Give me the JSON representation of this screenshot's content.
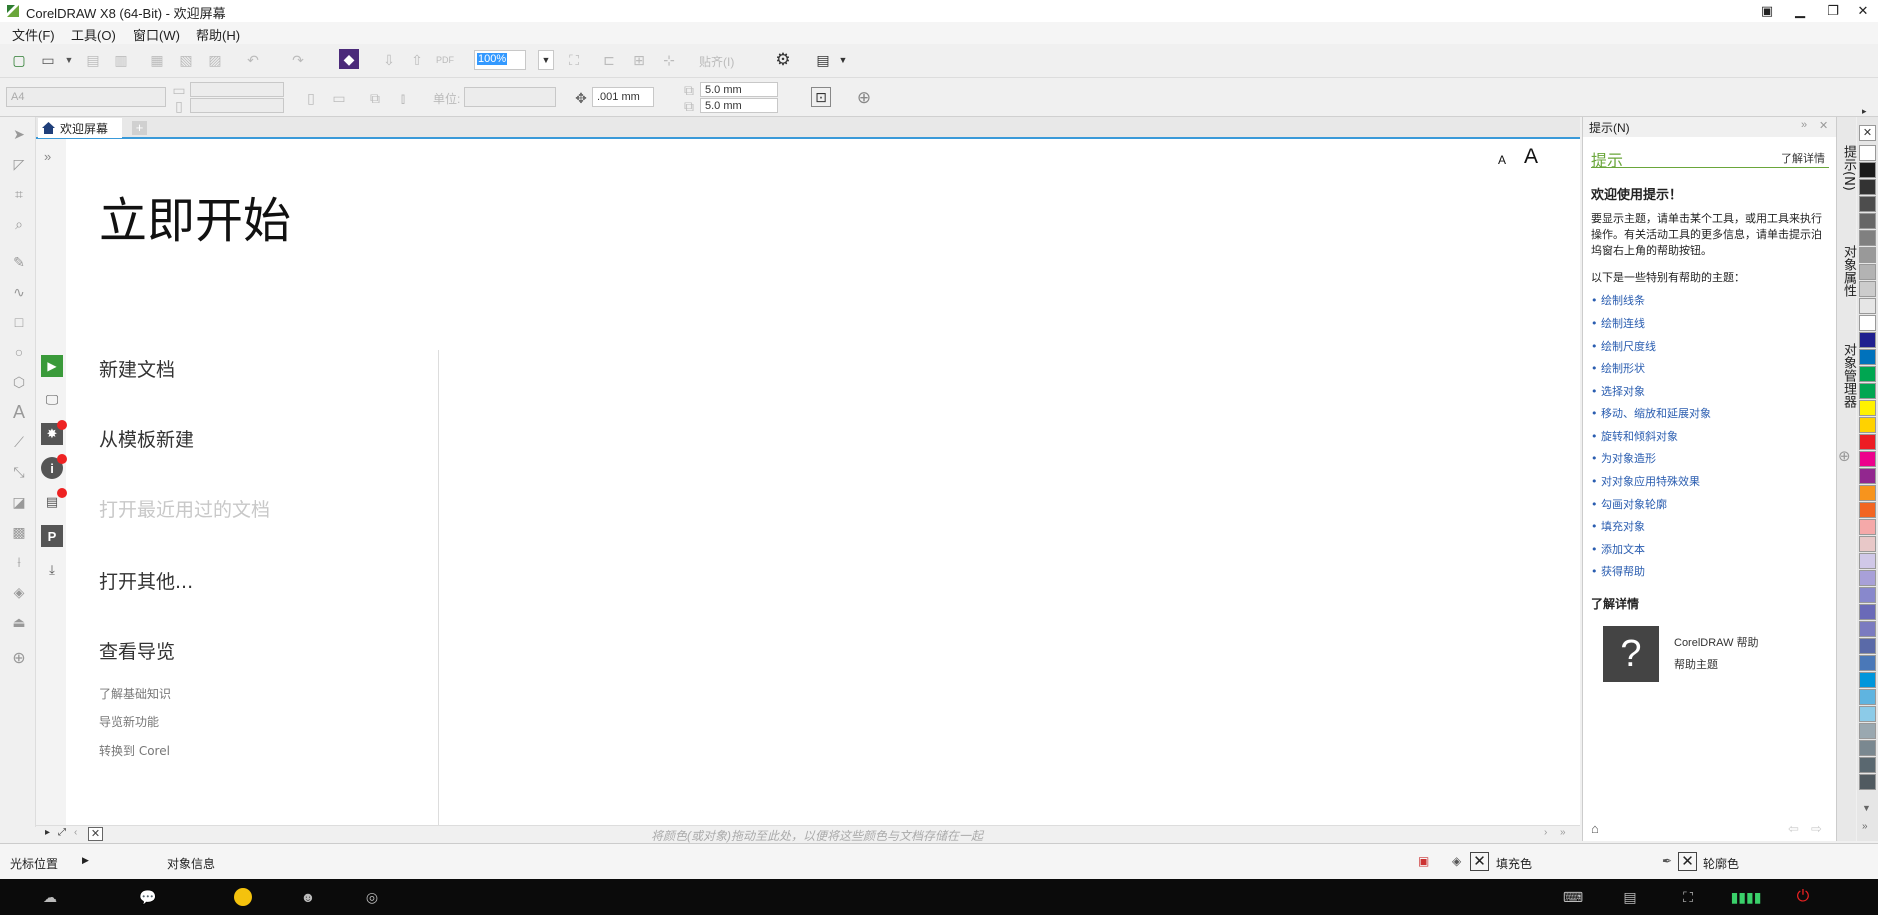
{
  "window": {
    "title": "CorelDRAW X8 (64-Bit) - 欢迎屏幕",
    "controls": [
      "minimize-icon",
      "restore-icon",
      "close-icon"
    ]
  },
  "menu": [
    "文件(F)",
    "工具(O)",
    "窗口(W)",
    "帮助(H)"
  ],
  "toolbar": {
    "zoom": "100%",
    "snap_label": "贴齐(I)",
    "page_size": "A4",
    "units_label": "单位:",
    "nudge": ".001 mm",
    "dup_x": "5.0 mm",
    "dup_y": "5.0 mm"
  },
  "tabs": {
    "welcome": "欢迎屏幕",
    "add": "+"
  },
  "welcome": {
    "title": "立即开始",
    "font_small": "A",
    "font_large": "A",
    "nav": [
      "新建文档",
      "从模板新建",
      "打开最近用过的文档",
      "打开其他...",
      "查看导览"
    ],
    "sublinks": [
      "了解基础知识",
      "导览新功能",
      "转换到 Corel"
    ]
  },
  "colorbar_hint": "将颜色(或对象)拖动至此处，以便将这些颜色与文档存储在一起",
  "hints": {
    "header": "提示(N)",
    "tab": "提示",
    "more": "了解详情",
    "welcome": "欢迎使用提示！",
    "body": "要显示主题，请单击某个工具，或用工具来执行操作。有关活动工具的更多信息，请单击提示泊坞窗右上角的帮助按钮。",
    "sub": "以下是一些特别有帮助的主题：",
    "links": [
      "• 绘制线条",
      "• 绘制连线",
      "• 绘制尺度线",
      "• 绘制形状",
      "• 选择对象",
      "• 移动、缩放和延展对象",
      "• 旋转和倾斜对象",
      "• 为对象造形",
      "• 对对象应用特殊效果",
      "• 勾画对象轮廓",
      "• 填充对象",
      "• 添加文本",
      "• 获得帮助"
    ],
    "learn": "了解详情",
    "help_icon": "?",
    "help_name": "CorelDRAW 帮助",
    "help_topics": "帮助主题"
  },
  "docker_tabs": [
    "提示(N)",
    "对象属性",
    "对象管理器"
  ],
  "palette": [
    "#ffffff",
    "#1a1a1a",
    "#333333",
    "#4d4d4d",
    "#666666",
    "#808080",
    "#999999",
    "#b3b3b3",
    "#cccccc",
    "#e6e6e6",
    "#ffffff",
    "#1f1f8f",
    "#0072bc",
    "#00a651",
    "#00a651",
    "#fff200",
    "#ffd200",
    "#ed1c24",
    "#ec008c",
    "#92278f",
    "#f7941d",
    "#f26522",
    "#f5a9a9",
    "#e8c8c8",
    "#d0c8e8",
    "#a8a0d8",
    "#8888cc",
    "#6a6ab8",
    "#7b7bc0",
    "#5a6aa8",
    "#4a78b8",
    "#0096db",
    "#5fb4e0",
    "#8ccbe8",
    "#9aa8b0",
    "#7a8890",
    "#5a6870",
    "#505a60"
  ],
  "status": {
    "cursor": "光标位置",
    "object_info": "对象信息",
    "fill": "填充色",
    "outline": "轮廓色"
  }
}
